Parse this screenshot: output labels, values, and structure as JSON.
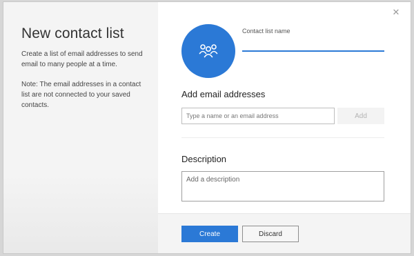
{
  "dialog": {
    "title": "New contact list",
    "description": "Create a list of email addresses to send email to many people at a time.",
    "note": "Note: The email addresses in a contact list are not connected to your saved contacts.",
    "close_icon": "close-icon"
  },
  "avatar": {
    "icon": "group-icon",
    "color": "#2b79d6"
  },
  "contact_list_name": {
    "label": "Contact list name",
    "value": ""
  },
  "add_emails": {
    "heading": "Add email addresses",
    "placeholder": "Type a name or an email address",
    "add_label": "Add"
  },
  "description_section": {
    "heading": "Description",
    "placeholder": "Add a description"
  },
  "footer": {
    "create_label": "Create",
    "discard_label": "Discard"
  },
  "colors": {
    "accent": "#2b79d6"
  }
}
